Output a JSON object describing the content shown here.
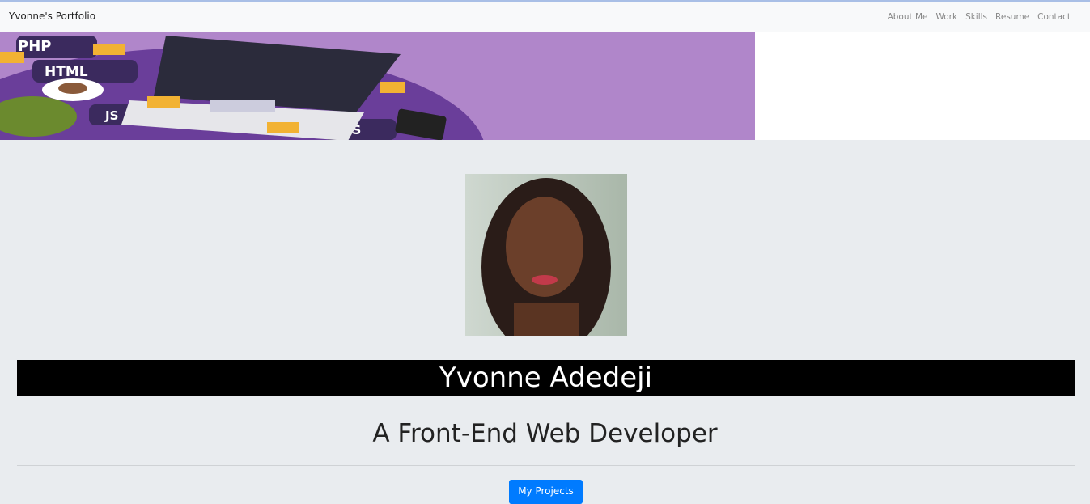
{
  "nav": {
    "brand": "Yvonne's Portfolio",
    "links": [
      "About Me",
      "Work",
      "Skills",
      "Resume",
      "Contact"
    ]
  },
  "banner": {
    "labels": [
      "PHP",
      "HTML",
      "JS",
      "CSS"
    ]
  },
  "hero": {
    "name": "Yvonne Adedeji",
    "subtitle": "A Front-End Web Developer",
    "button": "My Projects"
  }
}
